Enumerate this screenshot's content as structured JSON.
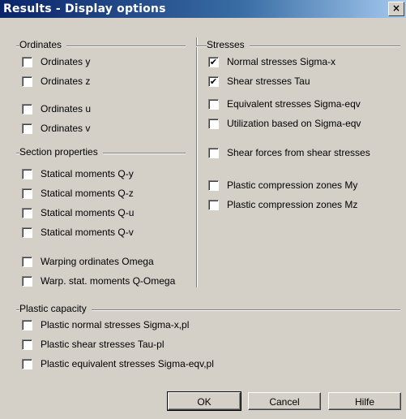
{
  "window": {
    "title": "Results - Display options",
    "close_label": "×"
  },
  "groups": {
    "ordinates": "Ordinates",
    "section_properties": "Section properties",
    "stresses": "Stresses",
    "plastic_capacity": "Plastic capacity"
  },
  "checkboxes": [
    {
      "label": "Ordinates y",
      "checked": false
    },
    {
      "label": "Ordinates z",
      "checked": false
    },
    {
      "label": "Ordinates u",
      "checked": false
    },
    {
      "label": "Ordinates v",
      "checked": false
    },
    {
      "label": "Statical moments Q-y",
      "checked": false
    },
    {
      "label": "Statical moments Q-z",
      "checked": false
    },
    {
      "label": "Statical moments Q-u",
      "checked": false
    },
    {
      "label": "Statical moments Q-v",
      "checked": false
    },
    {
      "label": "Warping ordinates Omega",
      "checked": false
    },
    {
      "label": "Warp. stat. moments Q-Omega",
      "checked": false
    },
    {
      "label": "Normal stresses Sigma-x",
      "checked": true
    },
    {
      "label": "Shear stresses Tau",
      "checked": true
    },
    {
      "label": "Equivalent stresses Sigma-eqv",
      "checked": false
    },
    {
      "label": "Utilization based on Sigma-eqv",
      "checked": false
    },
    {
      "label": "Shear forces from shear stresses",
      "checked": false
    },
    {
      "label": "Plastic compression zones My",
      "checked": false
    },
    {
      "label": "Plastic compression zones Mz",
      "checked": false
    },
    {
      "label": "Plastic normal stresses Sigma-x,pl",
      "checked": false
    },
    {
      "label": "Plastic shear stresses Tau-pl",
      "checked": false
    },
    {
      "label": "Plastic equivalent stresses  Sigma-eqv,pl",
      "checked": false
    }
  ],
  "buttons": {
    "ok": "OK",
    "cancel": "Cancel",
    "help": "Hilfe"
  }
}
